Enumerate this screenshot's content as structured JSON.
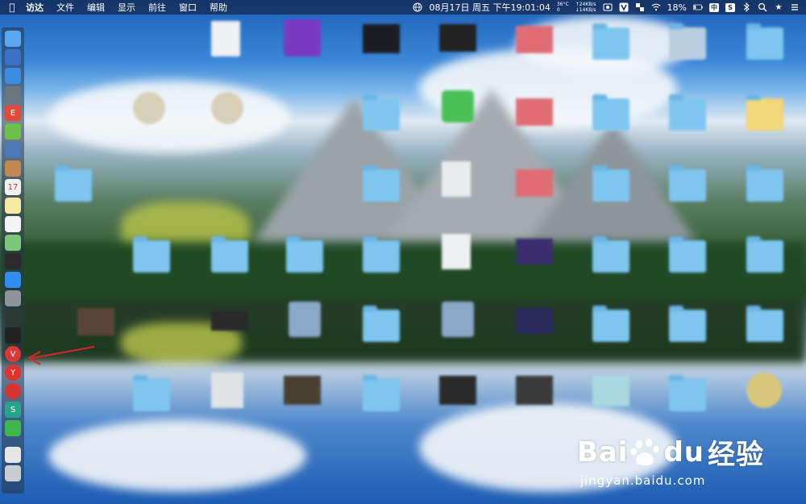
{
  "menubar": {
    "apple_icon": "apple-icon",
    "items": [
      "访达",
      "文件",
      "编辑",
      "显示",
      "前往",
      "窗口",
      "帮助"
    ],
    "status": {
      "globe_icon": "globe-icon",
      "date_time": "08月17日 周五 下午19:01:04",
      "temp": "36°C",
      "fan": "0",
      "upload": "↑24KB/s",
      "download": "↓14KB/s",
      "battery": "18%",
      "input_method": "中",
      "s_badge": "S"
    }
  },
  "dock": {
    "items": [
      {
        "name": "finder",
        "color": "#5aa9f0"
      },
      {
        "name": "launchpad",
        "color": "#3a72c9"
      },
      {
        "name": "safari",
        "color": "#3e8ce0"
      },
      {
        "name": "rocket",
        "color": "#6b7580"
      },
      {
        "name": "calendar-red",
        "color": "#e24a3b",
        "glyph": "E"
      },
      {
        "name": "android",
        "color": "#6cc04a"
      },
      {
        "name": "preview",
        "color": "#4d79b8"
      },
      {
        "name": "notebook",
        "color": "#c08a52"
      },
      {
        "name": "calendar",
        "color": "#f2f2f2",
        "glyph": "17"
      },
      {
        "name": "notes",
        "color": "#f3e9a0"
      },
      {
        "name": "textedit",
        "color": "#f4f4f4"
      },
      {
        "name": "maps",
        "color": "#7dc77a"
      },
      {
        "name": "terminal-green",
        "color": "#2b2b2b"
      },
      {
        "name": "app-store",
        "color": "#2f8ef0"
      },
      {
        "name": "system-preferences",
        "color": "#8d9399"
      },
      {
        "name": "activity-monitor",
        "color": "#2d3a33"
      },
      {
        "name": "terminal",
        "color": "#222"
      },
      {
        "name": "vivaldi",
        "color": "#d93a36",
        "glyph": "V"
      },
      {
        "name": "yandex",
        "color": "#e2322b",
        "glyph": "Y"
      },
      {
        "name": "netease-music",
        "color": "#d6362f"
      },
      {
        "name": "sogou",
        "color": "#2aa58b",
        "glyph": "S"
      },
      {
        "name": "wechat",
        "color": "#3eb64a"
      },
      {
        "name": "document",
        "color": "#e6e6e6"
      },
      {
        "name": "trash",
        "color": "#c9ced3"
      }
    ]
  },
  "watermark": {
    "brand_left": "Bai",
    "brand_right": "du",
    "brand_cn": "经验",
    "url": "jingyan.baidu.com"
  }
}
